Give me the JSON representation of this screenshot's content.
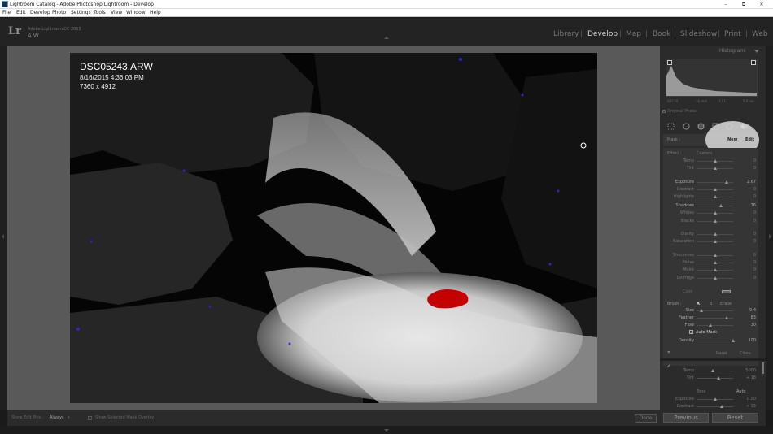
{
  "window": {
    "title": "Lightroom Catalog - Adobe Photoshop Lightroom - Develop",
    "minimize": "–",
    "maximize": "⧉",
    "close": "✕"
  },
  "menu": [
    "File",
    "Edit",
    "Develop",
    "Photo",
    "Settings",
    "Tools",
    "View",
    "Window",
    "Help"
  ],
  "identity": {
    "logo": "Lr",
    "product": "Adobe Lightroom CC 2015",
    "user": "A.W"
  },
  "modules": [
    "Library",
    "Develop",
    "Map",
    "Book",
    "Slideshow",
    "Print",
    "Web"
  ],
  "active_module": "Develop",
  "image_info": {
    "filename": "DSC05243.ARW",
    "datetime": "8/16/2015 4:36:03 PM",
    "dimensions": "7360 x 4912"
  },
  "toolbar": {
    "show_edit_pins_label": "Show Edit Pins :",
    "show_edit_pins_value": "Always",
    "show_mask_overlay_label": "Show Selected Mask Overlay",
    "done_label": "Done"
  },
  "histogram": {
    "title": "Histogram",
    "info": [
      "ISO 50",
      "16 mm",
      "f / 13",
      "5.0 sec"
    ],
    "original_photo": "Original Photo"
  },
  "local_adjust": {
    "mask_label": "Mask :",
    "new_label": "New",
    "edit_label": "Edit",
    "effect_label": "Effect :",
    "effect_value": "Custom"
  },
  "sliders": [
    {
      "name": "Temp",
      "value": "0"
    },
    {
      "name": "Tint",
      "value": "0"
    },
    {
      "name": "Exposure",
      "value": "2.67"
    },
    {
      "name": "Contrast",
      "value": "0"
    },
    {
      "name": "Highlights",
      "value": "0"
    },
    {
      "name": "Shadows",
      "value": "36"
    },
    {
      "name": "Whites",
      "value": "0"
    },
    {
      "name": "Blacks",
      "value": "0"
    },
    {
      "name": "Clarity",
      "value": "0"
    },
    {
      "name": "Saturation",
      "value": "0"
    },
    {
      "name": "Sharpness",
      "value": "0"
    },
    {
      "name": "Noise",
      "value": "0"
    },
    {
      "name": "Moiré",
      "value": "0"
    },
    {
      "name": "Defringe",
      "value": "0"
    }
  ],
  "color_label": "Color",
  "brush": {
    "label": "Brush :",
    "a": "A",
    "b": "B",
    "erase": "Erase",
    "size": {
      "name": "Size",
      "value": "9.4"
    },
    "feather": {
      "name": "Feather",
      "value": "83"
    },
    "flow": {
      "name": "Flow",
      "value": "30"
    },
    "auto_mask": "Auto Mask",
    "density": {
      "name": "Density",
      "value": "100"
    }
  },
  "panel_actions": {
    "reset": "Reset",
    "close": "Close"
  },
  "basic": {
    "temp": {
      "name": "Temp",
      "value": "5000"
    },
    "tint": {
      "name": "Tint",
      "value": "+ 18"
    },
    "tone": "Tone",
    "auto": "Auto",
    "exposure": {
      "name": "Exposure",
      "value": "0.00"
    },
    "contrast": {
      "name": "Contrast",
      "value": "+ 33"
    }
  },
  "buttons": {
    "previous": "Previous",
    "reset": "Reset"
  }
}
